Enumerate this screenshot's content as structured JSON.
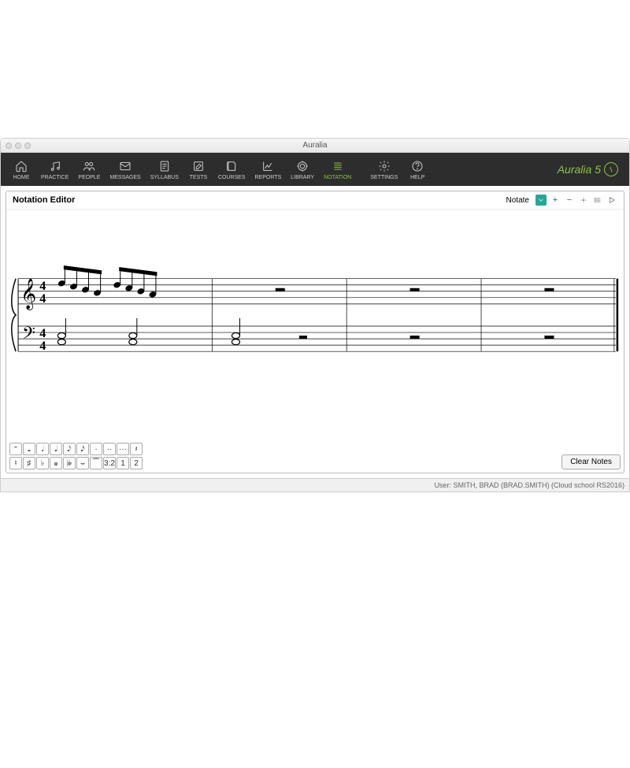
{
  "window": {
    "title": "Auralia"
  },
  "brand": {
    "name": "Auralia",
    "version": "5"
  },
  "nav": {
    "items": [
      {
        "key": "home",
        "label": "HOME"
      },
      {
        "key": "practice",
        "label": "PRACTICE"
      },
      {
        "key": "people",
        "label": "PEOPLE"
      },
      {
        "key": "messages",
        "label": "MESSAGES"
      },
      {
        "key": "syllabus",
        "label": "SYLLABUS"
      },
      {
        "key": "tests",
        "label": "TESTS"
      },
      {
        "key": "courses",
        "label": "COURSES"
      },
      {
        "key": "reports",
        "label": "REPORTS"
      },
      {
        "key": "library",
        "label": "LIBRARY"
      },
      {
        "key": "notation",
        "label": "NOTATION",
        "active": true
      },
      {
        "key": "settings",
        "label": "SETTINGS"
      },
      {
        "key": "help",
        "label": "HELP"
      }
    ]
  },
  "panel": {
    "title": "Notation Editor",
    "mode": "Notate"
  },
  "score": {
    "time_signature": "4/4",
    "staves": [
      "treble",
      "bass"
    ],
    "measures": 4,
    "treble_notes_measure1": "beamed-eighth-group x2 (descending)",
    "bass_content": "whole-note chords + half rests",
    "rest_measures": "whole rests"
  },
  "palette": {
    "row1": [
      "𝄻",
      "𝅝",
      "𝅗𝅥",
      "𝅘𝅥",
      "𝅘𝅥𝅮",
      "𝅘𝅥𝅯",
      "·",
      "··",
      "···",
      "𝄽"
    ],
    "row2": [
      "♮",
      "♯",
      "♭",
      "𝄪",
      "𝄫",
      "⌣",
      "⁀",
      "3:2",
      "1",
      "2"
    ]
  },
  "buttons": {
    "clear": "Clear Notes"
  },
  "status": {
    "user": "User: SMITH, BRAD (BRAD.SMITH) (Cloud school RS2016)"
  },
  "colors": {
    "accent": "#8bc34a",
    "teal": "#26a69a",
    "navbar": "#2d2d2d"
  }
}
